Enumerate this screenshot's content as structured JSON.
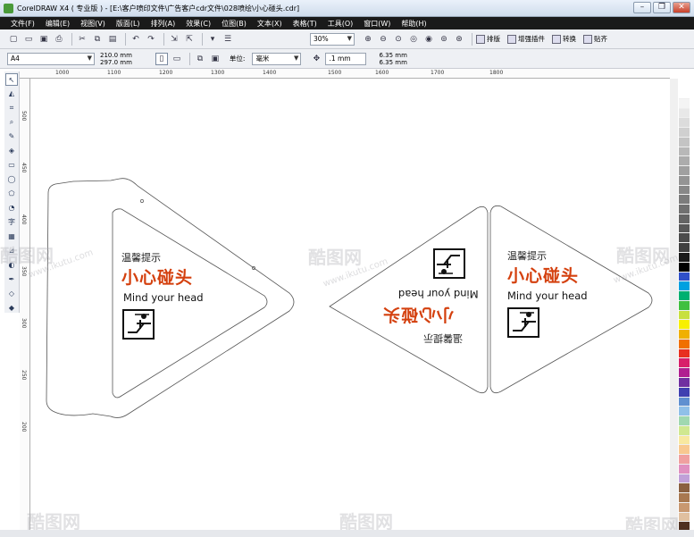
{
  "window": {
    "title": "CorelDRAW X4 ( 专业版 ) - [E:\\客户喷印文件\\广告客户cdr文件\\028喷绘\\小心碰头.cdr]",
    "controls": [
      "–",
      "❐",
      "✕"
    ]
  },
  "menu": [
    "文件(F)",
    "编辑(E)",
    "视图(V)",
    "版面(L)",
    "排列(A)",
    "效果(C)",
    "位图(B)",
    "文本(X)",
    "表格(T)",
    "工具(O)",
    "窗口(W)",
    "帮助(H)"
  ],
  "toolbar1": {
    "zoom": "30%",
    "buttons": [
      "排版",
      "增强插件",
      "转换",
      "贴齐"
    ]
  },
  "toolbar2": {
    "paper_size": "A4",
    "width": "210.0 mm",
    "height": "297.0 mm",
    "units_label": "单位:",
    "units_value": "毫米",
    "nudge": ".1 mm",
    "dup_x": "6.35 mm",
    "dup_y": "6.35 mm"
  },
  "ruler_h": [
    "1000",
    "1100",
    "1200",
    "1300",
    "1400",
    "1500",
    "1600",
    "1700",
    "1800"
  ],
  "ruler_v": [
    "500",
    "450",
    "400",
    "350",
    "300",
    "250",
    "200"
  ],
  "sign": {
    "heading": "温馨提示",
    "big_text": "小心碰头",
    "english": "Mind your head"
  },
  "watermark": {
    "cn": "酷图网",
    "url": "www.ikutu.com"
  },
  "palette_colors": [
    "#ffffff",
    "#f4f4f4",
    "#e8e8e8",
    "#dcdcdc",
    "#d0d0d0",
    "#c4c4c4",
    "#b8b8b8",
    "#acacac",
    "#a0a0a0",
    "#949494",
    "#888888",
    "#7c7c7c",
    "#707070",
    "#646464",
    "#585858",
    "#4c4c4c",
    "#404040",
    "#1a1a1a",
    "#000000",
    "#3050c8",
    "#00a0e0",
    "#00b070",
    "#40c040",
    "#c8e040",
    "#f8f000",
    "#f0b000",
    "#f07000",
    "#e83020",
    "#d8206a",
    "#b02090",
    "#7030a0",
    "#4040b0",
    "#6090d0",
    "#90c0e8",
    "#a0d8b0",
    "#d0e890",
    "#f8e8a0",
    "#f8c890",
    "#f0a0a0",
    "#e090c0",
    "#c0a0d8",
    "#8a6040",
    "#a87850",
    "#c89870",
    "#e0c0a0",
    "#503020"
  ]
}
